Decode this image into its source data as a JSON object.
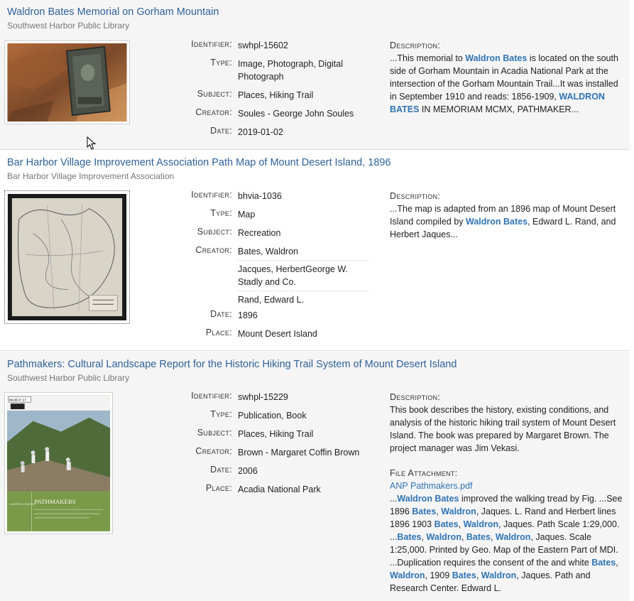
{
  "results": [
    {
      "title": "Waldron Bates Memorial on Gorham Mountain",
      "source": "Southwest Harbor Public Library",
      "labels": {
        "identifier": "Identifier:",
        "type": "Type:",
        "subject": "Subject:",
        "creator": "Creator:",
        "date": "Date:"
      },
      "identifier": "swhpl-15602",
      "type": "Image, Photograph, Digital Photograph",
      "subject": "Places, Hiking Trail",
      "creator": "Soules - George John Soules",
      "date": "2019-01-02",
      "description_label": "Description:",
      "description": {
        "p1": "...This memorial to ",
        "h1": "Waldron Bates",
        "p2": " is located on the south side of Gorham Mountain in Acadia National Park at the intersection of the Gorham Mountain Trail...It was installed in September 1910 and reads: 1856-1909, ",
        "h2": "WALDRON BATES",
        "p3": " IN MEMORIAM MCMX, PATHMAKER..."
      }
    },
    {
      "title": "Bar Harbor Village Improvement Association Path Map of Mount Desert Island, 1896",
      "source": "Bar Harbor Village Improvement Association",
      "labels": {
        "identifier": "Identifier:",
        "type": "Type:",
        "subject": "Subject:",
        "creator": "Creator:",
        "date": "Date:",
        "place": "Place:"
      },
      "identifier": "bhvia-1036",
      "type": "Map",
      "subject": "Recreation",
      "creators": [
        "Bates, Waldron",
        "Jacques, HerbertGeorge W. Stadly and Co.",
        "Rand, Edward L."
      ],
      "date": "1896",
      "place": "Mount Desert Island",
      "description_label": "Description:",
      "description": {
        "p1": "...The map is adapted from an 1896 map of Mount Desert Island compiled by ",
        "h1": "Waldron Bates",
        "p2": ", Edward L. Rand, and Herbert Jaques..."
      }
    },
    {
      "title": "Pathmakers: Cultural Landscape Report for the Historic Hiking Trail System of Mount Desert Island",
      "source": "Southwest Harbor Public Library",
      "labels": {
        "identifier": "Identifier:",
        "type": "Type:",
        "subject": "Subject:",
        "creator": "Creator:",
        "date": "Date:",
        "place": "Place:"
      },
      "identifier": "swhpl-15229",
      "type": "Publication, Book",
      "subject": "Places, Hiking Trail",
      "creator": "Brown - Margaret Coffin Brown",
      "date": "2006",
      "place": "Acadia National Park",
      "description_label": "Description:",
      "description_text": "This book describes the history, existing conditions, and analysis of the historic hiking trail system of Mount Desert Island. The book was prepared by Margaret Brown. The project manager was Jim Vekasi.",
      "attachment_label": "File Attachment:",
      "attachment_name": "ANP Pathmakers.pdf",
      "attachment_snippet": {
        "s1": "...",
        "h1": "Waldron Bates",
        "s2": " improved the walking tread by Fig. ...See 1896 ",
        "h2": "Bates",
        "c1": ", ",
        "h3": "Waldron",
        "s3": ", Jaques. L. Rand and Herbert lines 1896 1903 ",
        "h4": "Bates",
        "c2": ", ",
        "h5": "Waldron",
        "s4": ", Jaques. Path Scale 1:29,000. ...",
        "h6": "Bates",
        "c3": ", ",
        "h7": "Waldron",
        "c4": ", ",
        "h8": "Bates",
        "c5": ", ",
        "h9": "Waldron",
        "s5": ", Jaques. Scale 1:25,000. Printed by Geo. Map of the Eastern Part of MDI. ...Duplication requires the consent of the and white ",
        "h10": "Bates",
        "c6": ", ",
        "h11": "Waldron",
        "s6": ", 1909 ",
        "h12": "Bates",
        "c7": ", ",
        "h13": "Waldron",
        "s7": ", Jaques. Path and Research Center. Edward L."
      },
      "cover_text": {
        "title": "PATHMAKERS",
        "center": "OLMSTED CENTER",
        "label": "MUIR-P 27"
      }
    }
  ]
}
